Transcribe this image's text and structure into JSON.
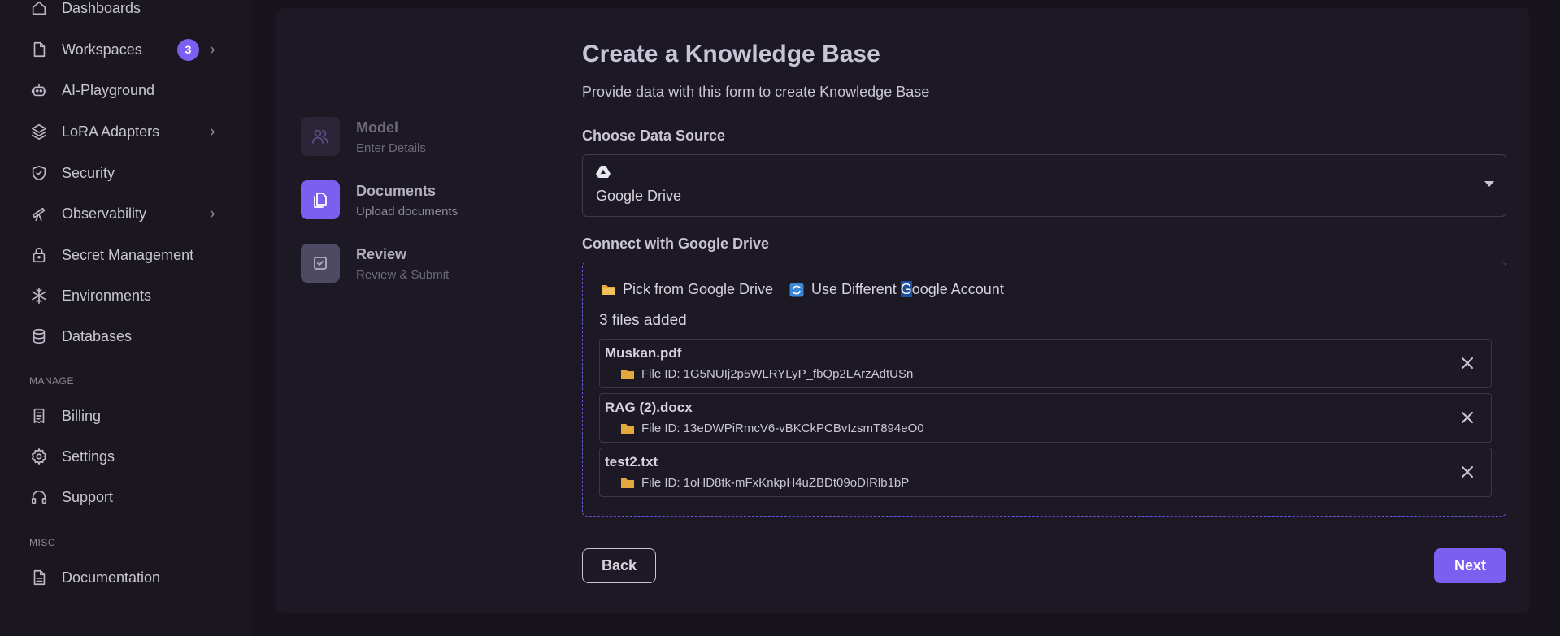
{
  "sidebar": {
    "items": [
      {
        "label": "Dashboards",
        "icon": "home-icon"
      },
      {
        "label": "Workspaces",
        "icon": "file-icon",
        "badge": "3",
        "chevron": "›"
      },
      {
        "label": "AI-Playground",
        "icon": "robot-icon"
      },
      {
        "label": "LoRA Adapters",
        "icon": "layers-icon",
        "chevron": "›"
      },
      {
        "label": "Security",
        "icon": "shield-icon"
      },
      {
        "label": "Observability",
        "icon": "telescope-icon",
        "chevron": "›"
      },
      {
        "label": "Secret Management",
        "icon": "lock-icon"
      },
      {
        "label": "Environments",
        "icon": "snowflake-icon"
      },
      {
        "label": "Databases",
        "icon": "database-icon"
      },
      {
        "label": "Billing",
        "icon": "receipt-icon"
      },
      {
        "label": "Settings",
        "icon": "gear-icon"
      },
      {
        "label": "Support",
        "icon": "headphones-icon"
      },
      {
        "label": "Documentation",
        "icon": "document-icon"
      }
    ],
    "sections": {
      "manage": "MANAGE",
      "misc": "MISC"
    }
  },
  "stepper": {
    "steps": [
      {
        "title": "Model",
        "subtitle": "Enter Details",
        "state": "inactive",
        "icon": "users-icon"
      },
      {
        "title": "Documents",
        "subtitle": "Upload documents",
        "state": "active",
        "icon": "copy-icon"
      },
      {
        "title": "Review",
        "subtitle": "Review & Submit",
        "state": "pending",
        "icon": "checkbox-icon"
      }
    ]
  },
  "form": {
    "title": "Create a Knowledge Base",
    "subtitle": "Provide data with this form to create Knowledge Base",
    "data_source_label": "Choose Data Source",
    "data_source_value": "Google Drive",
    "connect_label": "Connect with Google Drive",
    "pick_label": "Pick from Google Drive",
    "use_diff_pre": "Use Different ",
    "use_diff_hl": "G",
    "use_diff_post": "oogle Account",
    "files_count": "3 files added",
    "files": [
      {
        "name": "Muskan.pdf",
        "id": "File ID: 1G5NUIj2p5WLRYLyP_fbQp2LArzAdtUSn"
      },
      {
        "name": "RAG (2).docx",
        "id": "File ID: 13eDWPiRmcV6-vBKCkPCBvIzsmT894eO0"
      },
      {
        "name": "test2.txt",
        "id": "File ID: 1oHD8tk-mFxKnkpH4uZBDt09oDIRlb1bP"
      }
    ],
    "back_label": "Back",
    "next_label": "Next"
  },
  "colors": {
    "accent": "#7b5ff0",
    "background": "#1a1720",
    "card": "#1c1924",
    "folder": "#e3a93c"
  }
}
